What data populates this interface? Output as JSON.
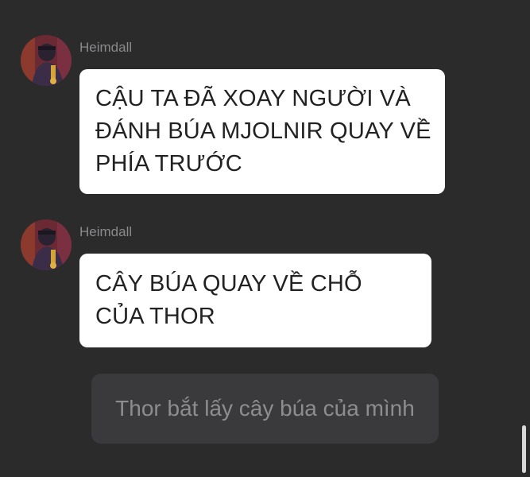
{
  "messages": [
    {
      "sender": "Heimdall",
      "avatar_icon": "avatar-icon",
      "lines": [
        "CẬU TA ĐÃ XOAY NGƯỜI VÀ",
        "ĐÁNH BÚA MJOLNIR QUAY VỀ",
        "PHÍA TRƯỚC"
      ]
    },
    {
      "sender": "Heimdall",
      "avatar_icon": "avatar-icon",
      "lines": [
        "CÂY BÚA QUAY VỀ CHỖ",
        "CỦA THOR"
      ]
    }
  ],
  "choice": {
    "label": "Thor bắt lấy cây búa của mình"
  },
  "colors": {
    "background": "#2b2b2c",
    "bubble": "#ffffff",
    "choice": "#3a3a3c",
    "sender": "#8a8a8c"
  }
}
